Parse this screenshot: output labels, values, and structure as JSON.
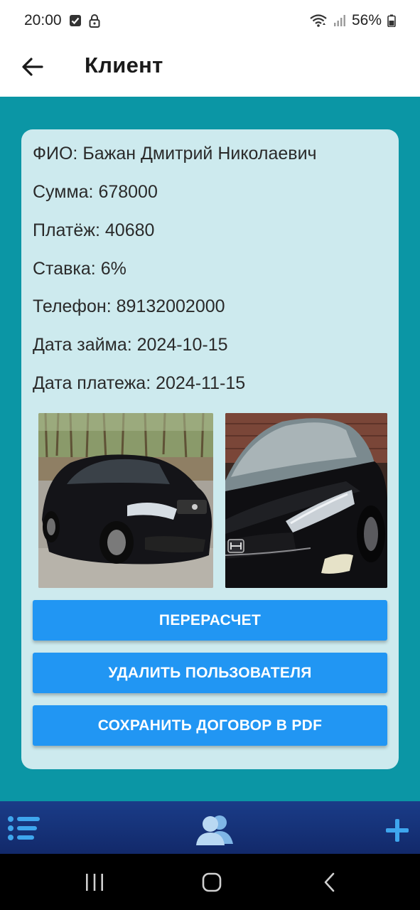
{
  "status_bar": {
    "time": "20:00",
    "battery": "56%",
    "icons": [
      "check-square-icon",
      "lock-icon",
      "wifi-icon",
      "signal-icon",
      "battery-icon"
    ]
  },
  "app_bar": {
    "title": "Клиент",
    "back_icon": "arrow-left-icon"
  },
  "client": {
    "fio": "ФИО: Бажан Дмитрий Николаевич",
    "sum": "Сумма: 678000",
    "payment": "Платёж: 40680",
    "rate": "Ставка: 6%",
    "phone": "Телефон: 89132002000",
    "loan_date": "Дата займа: 2024-10-15",
    "payment_date": "Дата платежа: 2024-11-15"
  },
  "photos": [
    {
      "name": "car-photo-side"
    },
    {
      "name": "car-photo-front"
    }
  ],
  "actions": {
    "recalc": "ПЕРЕРАСЧЕТ",
    "delete_user": "УДАЛИТЬ ПОЛЬЗОВАТЕЛЯ",
    "save_pdf": "СОХРАНИТЬ ДОГОВОР В PDF"
  },
  "bottom_bar": {
    "icons": [
      "list-icon",
      "users-icon",
      "plus-icon"
    ]
  },
  "system_nav": {
    "icons": [
      "recent-apps-icon",
      "home-icon",
      "back-icon"
    ]
  },
  "colors": {
    "background": "#0b96a5",
    "card": "#cdeaee",
    "button": "#2196f3",
    "bottom_bar": "#1a3c88"
  }
}
